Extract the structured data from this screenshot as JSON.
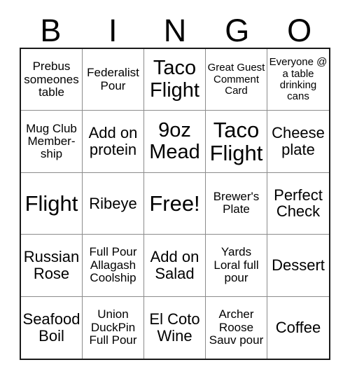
{
  "card": {
    "header_letters": [
      "B",
      "I",
      "N",
      "G",
      "O"
    ],
    "columns": 5,
    "rows": 5,
    "colors": {
      "background": "#ffffff",
      "text": "#000000",
      "outer_border": "#1a1a1a",
      "inner_border": "#8c8c8c"
    },
    "cells": [
      {
        "text": "Prebus someones table",
        "size": "sm"
      },
      {
        "text": "Federalist Pour",
        "size": "sm"
      },
      {
        "text": "Taco Flight",
        "size": "lg"
      },
      {
        "text": "Great Guest Comment Card",
        "size": "xs"
      },
      {
        "text": "Everyone @ a table drinking cans",
        "size": "xs"
      },
      {
        "text": "Mug Club Member-\nship",
        "size": "sm"
      },
      {
        "text": "Add on protein",
        "size": "md"
      },
      {
        "text": "9oz Mead",
        "size": "lg"
      },
      {
        "text": "Taco Flight",
        "size": "xl"
      },
      {
        "text": "Cheese plate",
        "size": "md"
      },
      {
        "text": "Flight",
        "size": "xl"
      },
      {
        "text": "Ribeye",
        "size": "md"
      },
      {
        "text": "Free!",
        "size": "xl"
      },
      {
        "text": "Brewer's Plate",
        "size": "sm"
      },
      {
        "text": "Perfect Check",
        "size": "md"
      },
      {
        "text": "Russian Rose",
        "size": "md"
      },
      {
        "text": "Full Pour Allagash Coolship",
        "size": "sm"
      },
      {
        "text": "Add on Salad",
        "size": "md"
      },
      {
        "text": "Yards Loral full pour",
        "size": "sm"
      },
      {
        "text": "Dessert",
        "size": "md"
      },
      {
        "text": "Seafood Boil",
        "size": "md"
      },
      {
        "text": "Union DuckPin Full Pour",
        "size": "sm"
      },
      {
        "text": "El Coto Wine",
        "size": "md"
      },
      {
        "text": "Archer Roose Sauv pour",
        "size": "sm"
      },
      {
        "text": "Coffee",
        "size": "md"
      }
    ]
  }
}
